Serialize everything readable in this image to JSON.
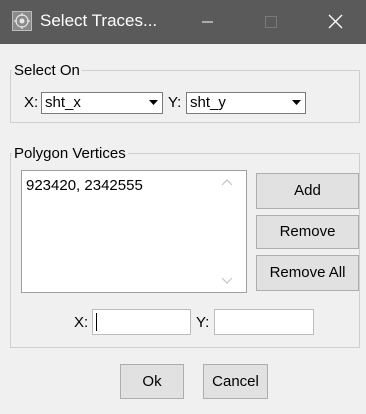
{
  "window": {
    "title": "Select Traces...",
    "controls": {
      "minimize": "minimize",
      "maximize": "maximize",
      "close": "close"
    }
  },
  "select_on": {
    "legend": "Select On",
    "x_label": "X:",
    "x_value": "sht_x",
    "y_label": "Y:",
    "y_value": "sht_y"
  },
  "polygon": {
    "legend": "Polygon Vertices",
    "vertices": [
      "923420, 2342555"
    ],
    "add_label": "Add",
    "remove_label": "Remove",
    "remove_all_label": "Remove All",
    "x_label": "X:",
    "y_label": "Y:",
    "x_value": "",
    "y_value": ""
  },
  "footer": {
    "ok_label": "Ok",
    "cancel_label": "Cancel"
  }
}
